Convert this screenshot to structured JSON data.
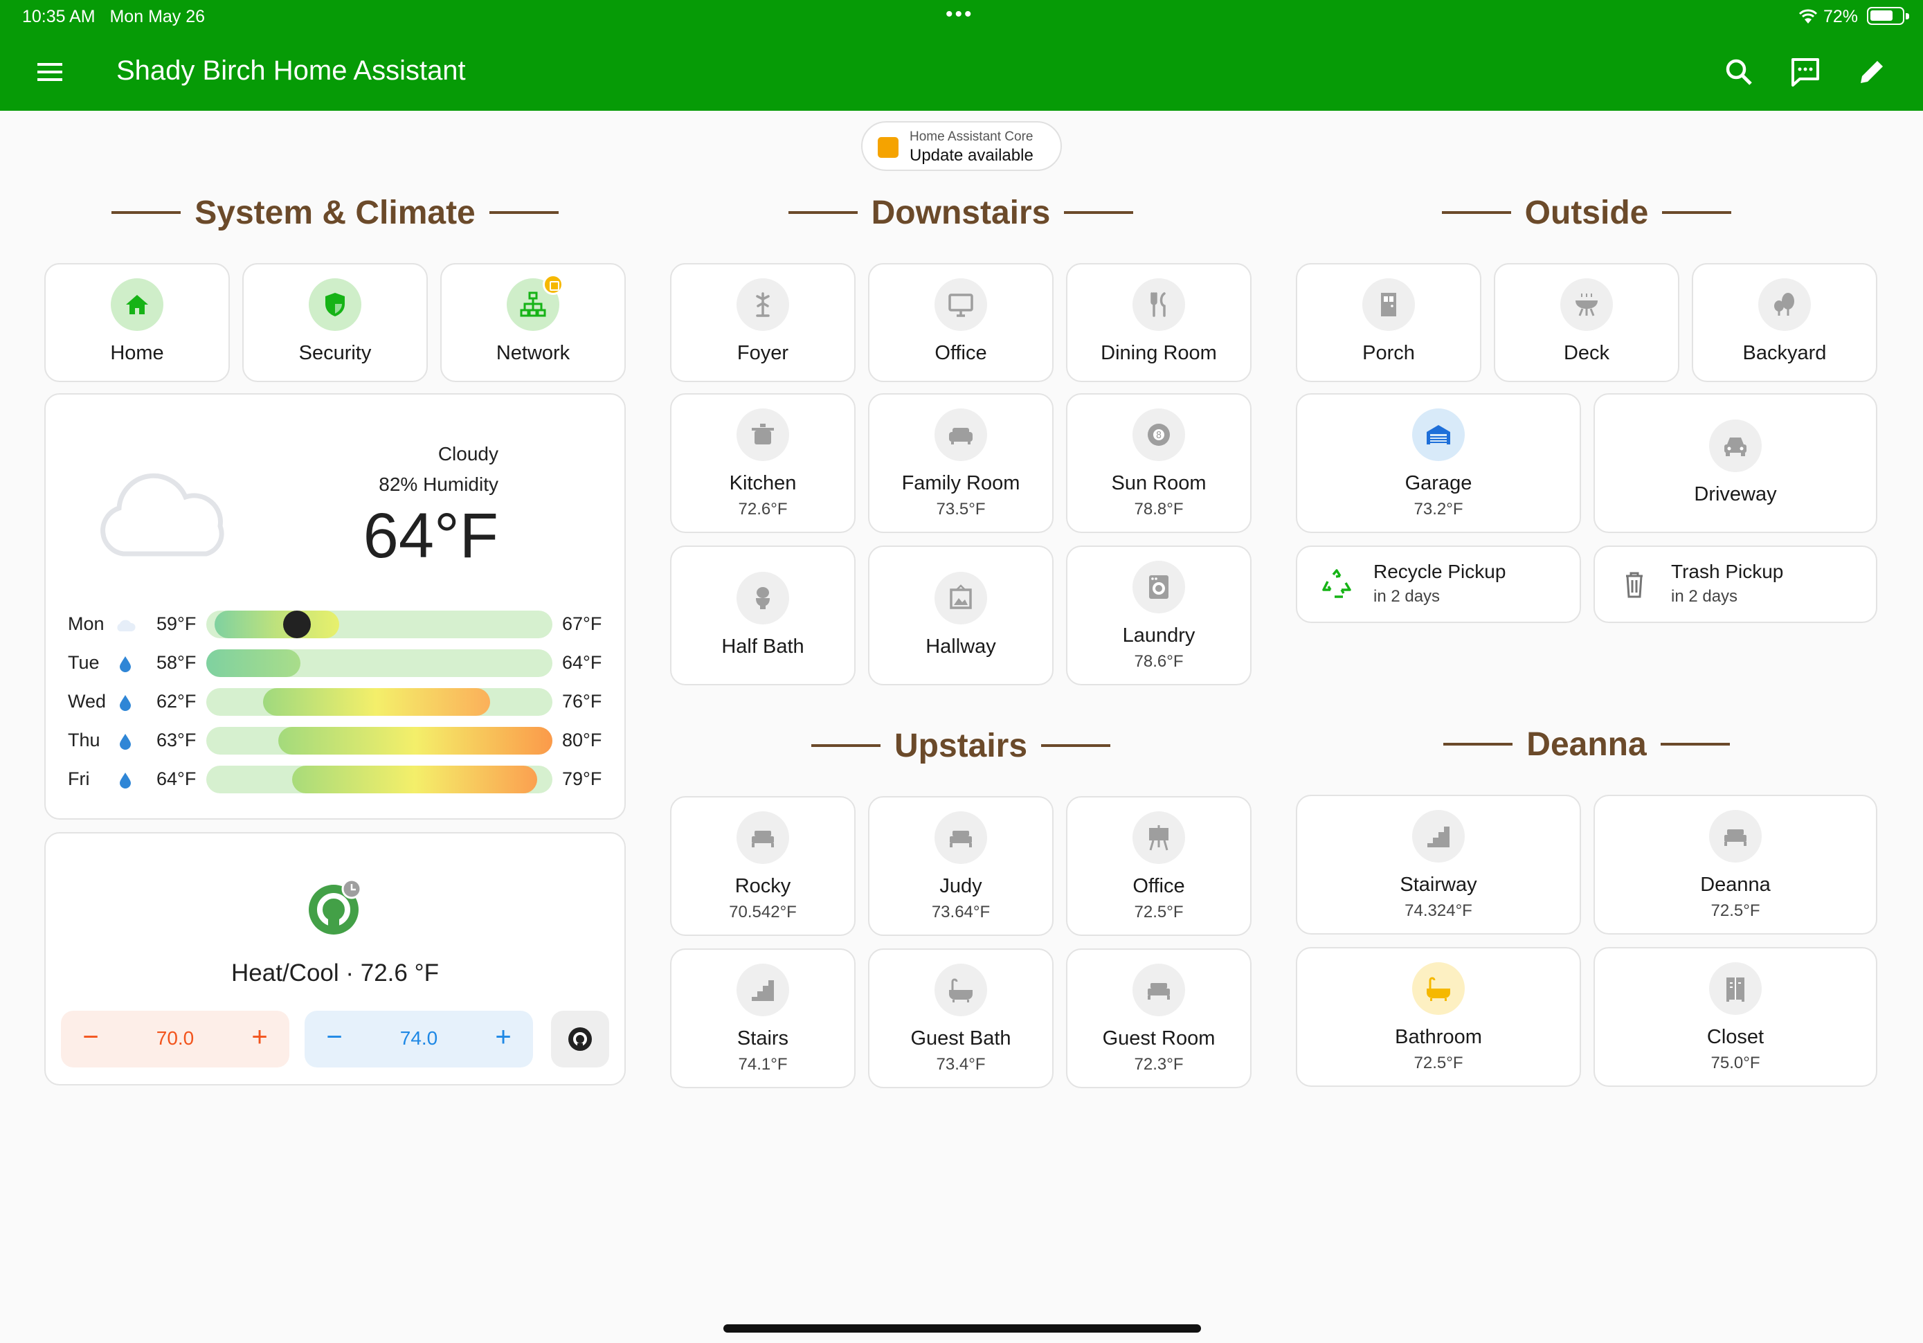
{
  "status": {
    "time": "10:35 AM",
    "date": "Mon May 26",
    "battery": "72%",
    "battery_level": 0.72
  },
  "appbar": {
    "title": "Shady Birch Home Assistant"
  },
  "update": {
    "subtitle": "Home Assistant Core",
    "label": "Update available"
  },
  "sections": {
    "system": "System & Climate",
    "downstairs": "Downstairs",
    "outside": "Outside",
    "upstairs": "Upstairs",
    "deanna": "Deanna"
  },
  "system_tiles": [
    {
      "name": "Home",
      "icon": "home-icon"
    },
    {
      "name": "Security",
      "icon": "shield-icon"
    },
    {
      "name": "Network",
      "icon": "network-icon"
    }
  ],
  "weather": {
    "condition": "Cloudy",
    "humidity": "82% Humidity",
    "temperature": "64°F",
    "forecast": [
      {
        "day": "Mon",
        "icon": "cloud-icon",
        "low": "59°F",
        "high": "67°F"
      },
      {
        "day": "Tue",
        "icon": "raindrop-icon",
        "low": "58°F",
        "high": "64°F"
      },
      {
        "day": "Wed",
        "icon": "raindrop-icon",
        "low": "62°F",
        "high": "76°F"
      },
      {
        "day": "Thu",
        "icon": "raindrop-icon",
        "low": "63°F",
        "high": "80°F"
      },
      {
        "day": "Fri",
        "icon": "raindrop-icon",
        "low": "64°F",
        "high": "79°F"
      }
    ]
  },
  "thermostat": {
    "mode": "Heat/Cool · 72.6 °F",
    "heat_setpoint": "70.0",
    "cool_setpoint": "74.0",
    "minus": "−",
    "plus": "+"
  },
  "downstairs": [
    {
      "name": "Foyer",
      "temp": "",
      "icon": "coat-rack-icon"
    },
    {
      "name": "Office",
      "temp": "",
      "icon": "monitor-icon"
    },
    {
      "name": "Dining Room",
      "temp": "",
      "icon": "silverware-icon"
    },
    {
      "name": "Kitchen",
      "temp": "72.6°F",
      "icon": "pot-icon"
    },
    {
      "name": "Family Room",
      "temp": "73.5°F",
      "icon": "sofa-icon"
    },
    {
      "name": "Sun Room",
      "temp": "78.8°F",
      "icon": "billiards-icon"
    },
    {
      "name": "Half Bath",
      "temp": "",
      "icon": "toilet-icon"
    },
    {
      "name": "Hallway",
      "temp": "",
      "icon": "picture-frame-icon"
    },
    {
      "name": "Laundry",
      "temp": "78.6°F",
      "icon": "washing-machine-icon"
    }
  ],
  "outside": [
    {
      "name": "Porch",
      "temp": "",
      "icon": "door-icon"
    },
    {
      "name": "Deck",
      "temp": "",
      "icon": "grill-icon"
    },
    {
      "name": "Backyard",
      "temp": "",
      "icon": "tree-icon"
    },
    {
      "name": "Garage",
      "temp": "73.2°F",
      "icon": "garage-icon"
    },
    {
      "name": "Driveway",
      "temp": "",
      "icon": "car-icon"
    }
  ],
  "pickups": [
    {
      "name": "Recycle Pickup",
      "when": "in 2 days",
      "icon": "recycle-icon"
    },
    {
      "name": "Trash Pickup",
      "when": "in 2 days",
      "icon": "trash-icon"
    }
  ],
  "upstairs": [
    {
      "name": "Rocky",
      "temp": "70.542°F",
      "icon": "bed-icon"
    },
    {
      "name": "Judy",
      "temp": "73.64°F",
      "icon": "bed-icon"
    },
    {
      "name": "Office",
      "temp": "72.5°F",
      "icon": "easel-icon"
    },
    {
      "name": "Stairs",
      "temp": "74.1°F",
      "icon": "stairs-icon"
    },
    {
      "name": "Guest Bath",
      "temp": "73.4°F",
      "icon": "bathtub-icon"
    },
    {
      "name": "Guest Room",
      "temp": "72.3°F",
      "icon": "bed-icon"
    }
  ],
  "deanna": [
    {
      "name": "Stairway",
      "temp": "74.324°F",
      "icon": "stairs-icon"
    },
    {
      "name": "Deanna",
      "temp": "72.5°F",
      "icon": "bed-icon"
    },
    {
      "name": "Bathroom",
      "temp": "72.5°F",
      "icon": "bathtub-icon"
    },
    {
      "name": "Closet",
      "temp": "75.0°F",
      "icon": "wardrobe-icon"
    }
  ],
  "colors": {
    "appbar": "#069b06",
    "section": "#6b4a2a",
    "heat": "#f2541d",
    "cool": "#1e88e5",
    "active_green": "#16b316"
  }
}
